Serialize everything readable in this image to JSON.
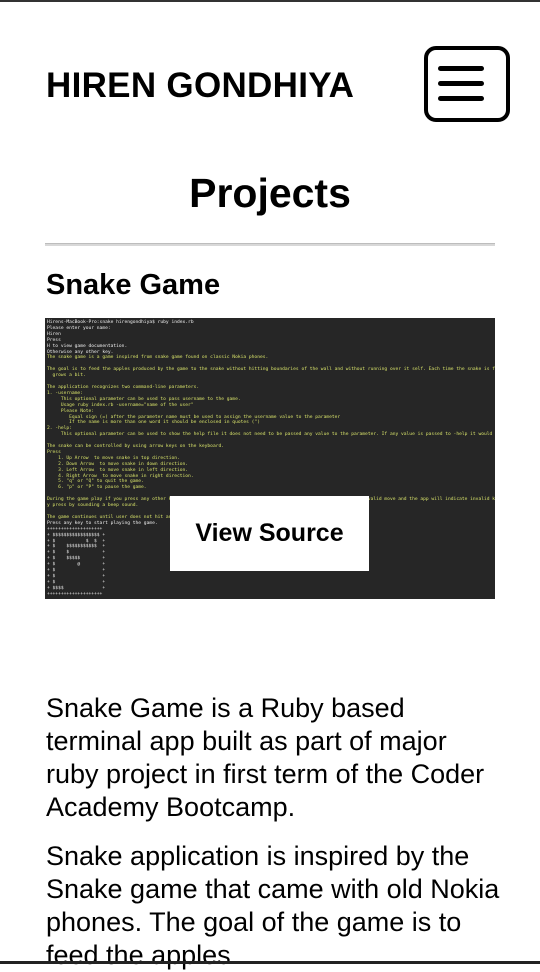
{
  "header": {
    "brand": "HIREN GONDHIYA",
    "menu_icon": "hamburger-menu-icon"
  },
  "page": {
    "title": "Projects"
  },
  "project": {
    "title": "Snake Game",
    "view_source_label": "View Source",
    "description_1": "Snake Game is a Ruby based terminal app built as part of major ruby project in first term of the Coder Academy Bootcamp.",
    "description_2": "Snake application is inspired by the Snake game that came with old Nokia phones. The goal of the game is to feed the apples",
    "terminal_lines": [
      {
        "t": "Hirens-MacBook-Pro:snake hirengondhiya$ ruby index.rb",
        "c": "w"
      },
      {
        "t": "Please enter your name:",
        "c": "w"
      },
      {
        "t": "Hiren",
        "c": "w"
      },
      {
        "t": "Press",
        "c": "w"
      },
      {
        "t": "H to view game documentation.",
        "c": "w"
      },
      {
        "t": "Otherwise any other key.",
        "c": "w"
      },
      {
        "t": "The snake game is a game inspired from snake game found on classic Nokia phones.",
        "c": "y"
      },
      {
        "t": "",
        "c": "w"
      },
      {
        "t": "The goal is to feed the apples produced by the game to the snake without hitting boundaries of the wall and without running over it self. Each time the snake is fed with an apple it",
        "c": "y"
      },
      {
        "t": "  grows a bit.",
        "c": "y"
      },
      {
        "t": "",
        "c": "w"
      },
      {
        "t": "The application recognizes two command-line parameters.",
        "c": "y"
      },
      {
        "t": "1. -username:",
        "c": "y"
      },
      {
        "t": "     This optional parameter can be used to pass username to the game.",
        "c": "y"
      },
      {
        "t": "     Usage ruby index.rb -username=\"name of the user\"",
        "c": "y"
      },
      {
        "t": "     Please Note:",
        "c": "y"
      },
      {
        "t": "        Equal sign (=) after the parameter name must be used to assign the username value to the parameter",
        "c": "y"
      },
      {
        "t": "        If the name is more than one word it should be enclosed in quotes (\")",
        "c": "y"
      },
      {
        "t": "2. -help:",
        "c": "y"
      },
      {
        "t": "     This optional parameter can be used to show the help file it does not need to be passed any value to the parameter. If any value is passed to -help it would be ignored.",
        "c": "y"
      },
      {
        "t": "",
        "c": "w"
      },
      {
        "t": "The snake can be controlled by using arrow keys on the keyboard.",
        "c": "y"
      },
      {
        "t": "Press",
        "c": "y"
      },
      {
        "t": "    1. Up Arrow  to move snake in top direction.",
        "c": "y"
      },
      {
        "t": "    2. Down Arrow  to move snake in down direction.",
        "c": "y"
      },
      {
        "t": "    3. Left Arrow  to move snake in left direction.",
        "c": "y"
      },
      {
        "t": "    4. Right Arrow  to move snake in right direction.",
        "c": "y"
      },
      {
        "t": "    5. \"q\" or \"Q\" to quit the game.",
        "c": "y"
      },
      {
        "t": "    6. \"p\" or \"P\" to pause the game.",
        "c": "y"
      },
      {
        "t": "",
        "c": "w"
      },
      {
        "t": "During the game play if you press any other key e                                                                  nvalid move and the app will indicate invalid ke",
        "c": "y"
      },
      {
        "t": "y press by sounding a beep sound.",
        "c": "y"
      },
      {
        "t": "",
        "c": "w"
      },
      {
        "t": "The game continues until user does not hit any of",
        "c": "y"
      },
      {
        "t": "Press any key to start playing the game.",
        "c": "w"
      },
      {
        "t": "++++++++++++++++++++",
        "c": "w"
      },
      {
        "t": "+ $$$$$$$$$$$$$$$$$ +",
        "c": "w"
      },
      {
        "t": "+ $           $  $  +",
        "c": "w"
      },
      {
        "t": "+ $    $$$$$$$$$$$  +",
        "c": "w"
      },
      {
        "t": "+ $    $            +",
        "c": "w"
      },
      {
        "t": "+ $    $$$$$        +",
        "c": "w"
      },
      {
        "t": "+ $        @        +",
        "c": "w"
      },
      {
        "t": "+ $                 +",
        "c": "w"
      },
      {
        "t": "+ $                 +",
        "c": "w"
      },
      {
        "t": "+ $                 +",
        "c": "w"
      },
      {
        "t": "+ $$$$              +",
        "c": "w"
      },
      {
        "t": "++++++++++++++++++++",
        "c": "w"
      }
    ]
  },
  "colors": {
    "terminal_bg": "#262626",
    "terminal_text": "#f0f0f0",
    "terminal_highlight": "#d8e36a"
  }
}
